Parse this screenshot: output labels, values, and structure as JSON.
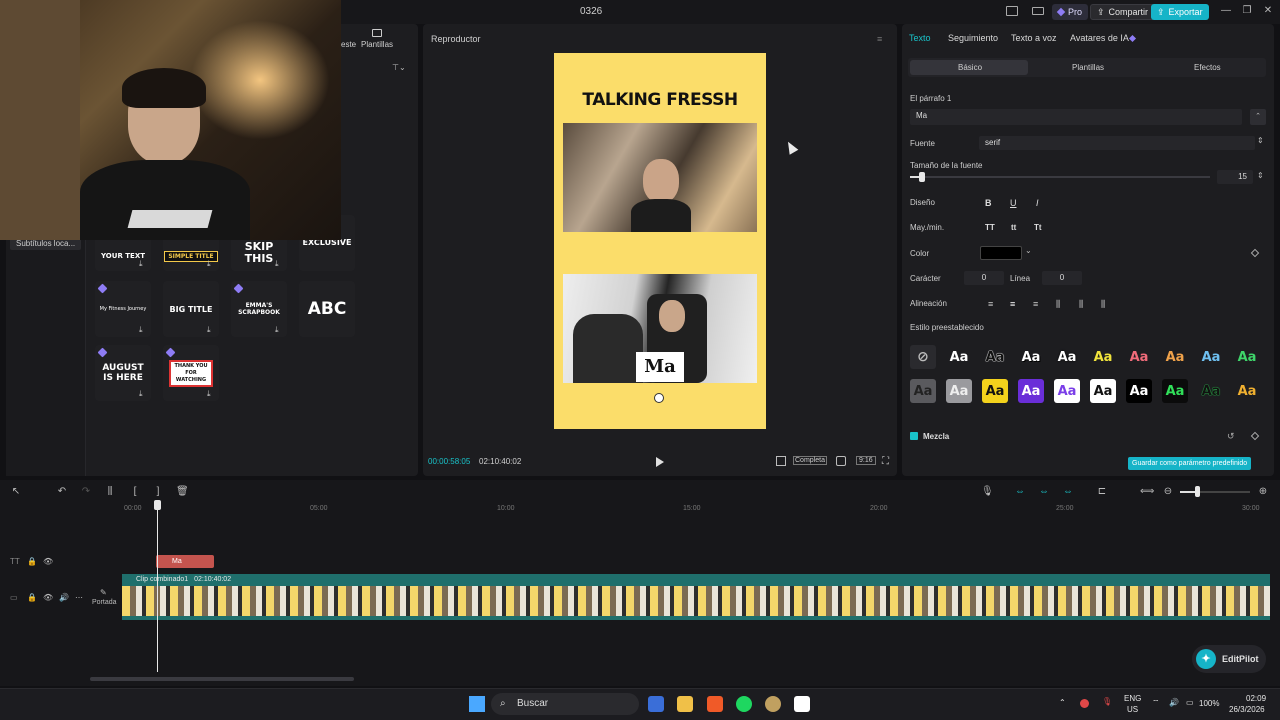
{
  "window": {
    "title": "0326",
    "pro_label": "Pro",
    "share_label": "Compartir",
    "export_label": "Exportar"
  },
  "left_panel": {
    "tabs": [
      "este",
      "Plantillas"
    ],
    "nav_item": "Subtítulos loca...",
    "templates": [
      {
        "text": "YOUR TEXT"
      },
      {
        "text": "SIMPLE TITLE"
      },
      {
        "text": "SKIP THIS"
      },
      {
        "text": "EXCLUSIVE"
      },
      {
        "text": "My Fitness Journey"
      },
      {
        "text": "BIG TITLE"
      },
      {
        "text": "EMMA'S SCRAPBOOK"
      },
      {
        "text": "ABC"
      },
      {
        "text": "AUGUST IS HERE"
      },
      {
        "text": "THANK YOU FOR WATCHING"
      }
    ]
  },
  "player": {
    "label": "Reproductor",
    "headline": "TALKING FRESSH",
    "caption": "Ma",
    "current_time": "00:00:58:05",
    "total_time": "02:10:40:02",
    "fit_label": "Completa",
    "ratio_label": "9:16"
  },
  "inspector": {
    "tabs": [
      "Texto",
      "Seguimiento",
      "Texto a voz",
      "Avatares de IA"
    ],
    "subtabs": [
      "Básico",
      "Plantillas",
      "Efectos"
    ],
    "paragraph_label": "El párrafo 1",
    "paragraph_value": "Ma",
    "font_label": "Fuente",
    "font_value": "serif",
    "font_size_label": "Tamaño de la fuente",
    "font_size_value": "15",
    "design_label": "Diseño",
    "case_label": "May./min.",
    "case_options": [
      "TT",
      "tt",
      "Tt"
    ],
    "color_label": "Color",
    "char_label": "Carácter",
    "char_value": "0",
    "line_label": "Línea",
    "line_value": "0",
    "align_label": "Alineación",
    "preset_style_label": "Estilo preestablecido",
    "preset_text": "Aa",
    "blend_label": "Mezcla",
    "save_preset_label": "Guardar como parámetro predefinido"
  },
  "timeline": {
    "ruler": [
      "00:00",
      "05:00",
      "10:00",
      "15:00",
      "20:00",
      "25:00",
      "30:00"
    ],
    "text_clip_label": "Ma",
    "video_clip_label": "Clip combinado1",
    "video_clip_duration": "02:10:40:02",
    "cover_label": "Portada",
    "editpilot_label": "EditPilot"
  },
  "taskbar": {
    "search_label": "Buscar",
    "language_top": "ENG",
    "language_bottom": "US",
    "battery": "100%",
    "time": "02:09",
    "date": "26/3/2026"
  },
  "colors": {
    "accent": "#16b4c8",
    "canvas_bg": "#fbdd6a",
    "text_clip": "#c4544e",
    "video_clip": "#1f6f6c"
  }
}
